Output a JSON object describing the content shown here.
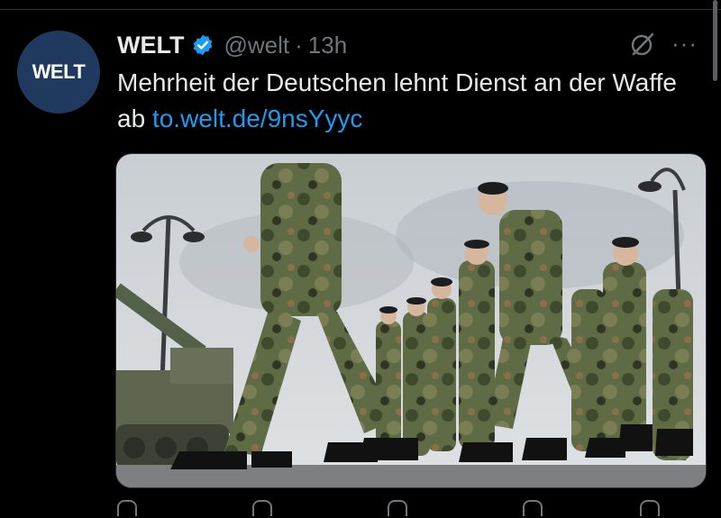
{
  "tweet": {
    "avatar_text": "WELT",
    "display_name": "WELT",
    "handle": "@welt",
    "separator": "·",
    "time": "13h",
    "text": "Mehrheit der Deutschen lehnt Dienst an der Waffe ab ",
    "link": "to.welt.de/9nsYyyc",
    "more_label": "···",
    "media": {
      "icon": "photo",
      "description_none": ""
    }
  },
  "colors": {
    "background": "#000000",
    "link": "#1d9bf0",
    "verified": "#1d9bf0",
    "muted": "#71767b",
    "avatar": "#1f3a5e"
  },
  "icons": {
    "verified": "verified-badge-icon",
    "grok": "grok-icon",
    "more": "more-icon",
    "reply": "reply-icon",
    "retweet": "retweet-icon",
    "like": "heart-icon",
    "views": "views-icon"
  }
}
